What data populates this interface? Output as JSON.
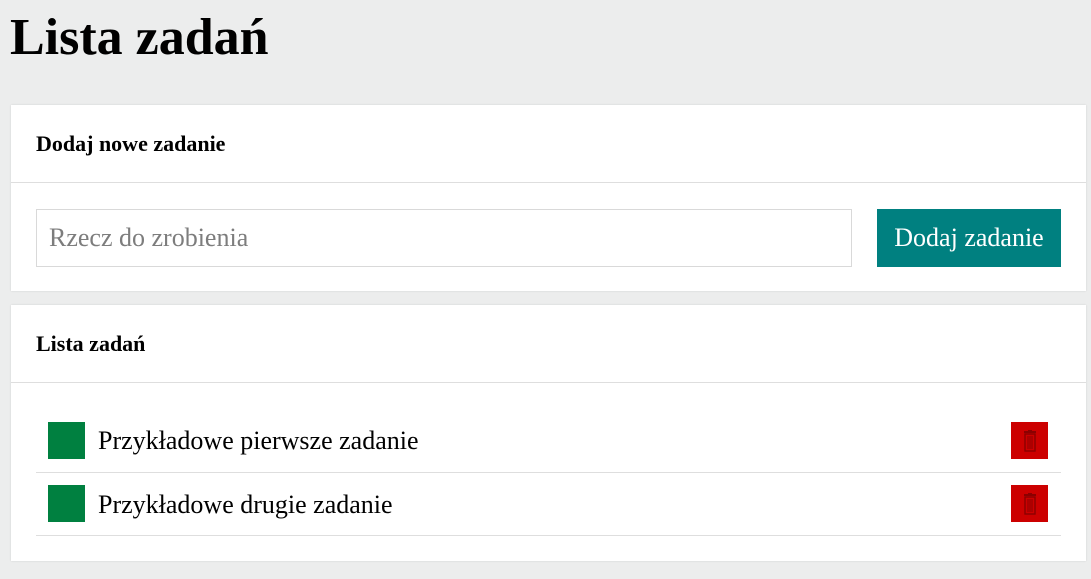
{
  "page": {
    "title": "Lista zadań"
  },
  "add_section": {
    "header": "Dodaj nowe zadanie",
    "input_value": "",
    "input_placeholder": "Rzecz do zrobienia",
    "button_label": "Dodaj zadanie"
  },
  "list_section": {
    "header": "Lista zadań",
    "tasks": [
      {
        "label": "Przykładowe pierwsze zadanie",
        "delete_icon": "trash-icon"
      },
      {
        "label": "Przykładowe drugie zadanie",
        "delete_icon": "trash-icon"
      }
    ]
  },
  "colors": {
    "background": "#eceded",
    "card": "#ffffff",
    "accent": "#008080",
    "task_checkbox": "#008040",
    "delete": "#cc0000"
  }
}
